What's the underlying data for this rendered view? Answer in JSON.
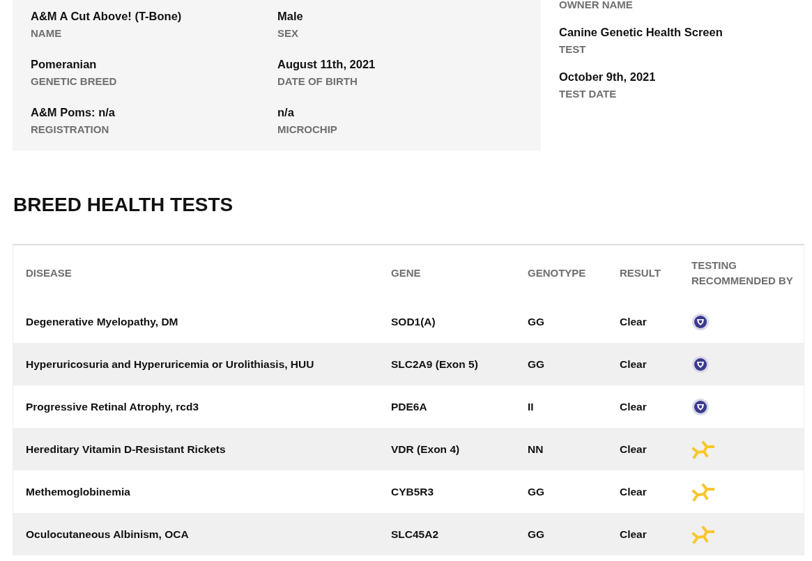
{
  "dog_info": [
    {
      "value": "A&M A Cut Above! (T-Bone)",
      "label": "NAME"
    },
    {
      "value": "Male",
      "label": "SEX"
    },
    {
      "value": "Pomeranian",
      "label": "GENETIC BREED"
    },
    {
      "value": "August 11th, 2021",
      "label": "DATE OF BIRTH"
    },
    {
      "value": "A&M Poms: n/a",
      "label": "REGISTRATION"
    },
    {
      "value": "n/a",
      "label": "MICROCHIP"
    }
  ],
  "test_info": {
    "owner_label": "OWNER NAME",
    "items": [
      {
        "value": "Canine Genetic Health Screen",
        "label": "TEST"
      },
      {
        "value": "October 9th, 2021",
        "label": "TEST DATE"
      }
    ]
  },
  "section_title": "BREED HEALTH TESTS",
  "table": {
    "columns": [
      "DISEASE",
      "GENE",
      "GENOTYPE",
      "RESULT",
      "TESTING RECOMMENDED BY"
    ],
    "rows": [
      {
        "disease": "Degenerative Myelopathy, DM",
        "gene": "SOD1(A)",
        "genotype": "GG",
        "result": "Clear",
        "kind": "seal"
      },
      {
        "disease": "Hyperuricosuria and Hyperuricemia or Urolithiasis, HUU",
        "gene": "SLC2A9 (Exon 5)",
        "genotype": "GG",
        "result": "Clear",
        "kind": "seal"
      },
      {
        "disease": "Progressive Retinal Atrophy, rcd3",
        "gene": "PDE6A",
        "genotype": "II",
        "result": "Clear",
        "kind": "seal"
      },
      {
        "disease": "Hereditary Vitamin D-Resistant Rickets",
        "gene": "VDR (Exon 4)",
        "genotype": "NN",
        "result": "Clear",
        "kind": "balloon"
      },
      {
        "disease": "Methemoglobinemia",
        "gene": "CYB5R3",
        "genotype": "GG",
        "result": "Clear",
        "kind": "balloon"
      },
      {
        "disease": "Oculocutaneous Albinism, OCA",
        "gene": "SLC45A2",
        "genotype": "GG",
        "result": "Clear",
        "kind": "balloon"
      }
    ]
  }
}
